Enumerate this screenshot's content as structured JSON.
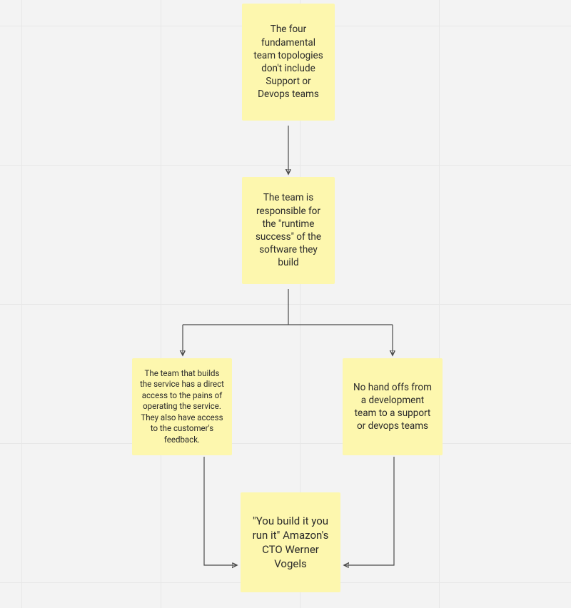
{
  "notes": {
    "a": "The four fundamental team topologies don't include Support or Devops teams",
    "b": "The team is responsible for the \"runtime success\" of the software they build",
    "c": "The team that builds the service  has a direct access to the pains of operating the service. They also have access to the customer's feedback.",
    "d": "No hand offs from a development team to a support or devops teams",
    "e": "\"You build it you run it\" Amazon's CTO Werner Vogels"
  }
}
